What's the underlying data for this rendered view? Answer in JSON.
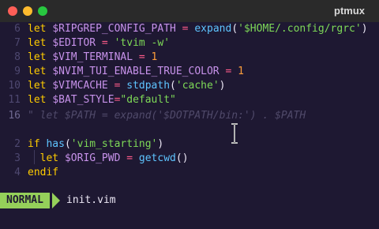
{
  "window": {
    "title": "ptmux"
  },
  "editor": {
    "lines": [
      {
        "num": "6",
        "tokens": [
          [
            "kw",
            "let "
          ],
          [
            "var",
            "$RIPGREP_CONFIG_PATH"
          ],
          [
            "op",
            " = "
          ],
          [
            "fn",
            "expand"
          ],
          [
            "plain",
            "("
          ],
          [
            "str",
            "'$HOME/.config/rgrc'"
          ],
          [
            "plain",
            ")"
          ]
        ]
      },
      {
        "num": "7",
        "tokens": [
          [
            "kw",
            "let "
          ],
          [
            "var",
            "$EDITOR"
          ],
          [
            "op",
            " = "
          ],
          [
            "str",
            "'tvim -w'"
          ]
        ]
      },
      {
        "num": "8",
        "tokens": [
          [
            "kw",
            "let "
          ],
          [
            "var",
            "$VIM_TERMINAL"
          ],
          [
            "op",
            " = "
          ],
          [
            "num",
            "1"
          ]
        ]
      },
      {
        "num": "9",
        "tokens": [
          [
            "kw",
            "let "
          ],
          [
            "var",
            "$NVIM_TUI_ENABLE_TRUE_COLOR"
          ],
          [
            "op",
            " = "
          ],
          [
            "num",
            "1"
          ]
        ]
      },
      {
        "num": "10",
        "tokens": [
          [
            "kw",
            "let "
          ],
          [
            "var",
            "$VIMCACHE"
          ],
          [
            "op",
            " = "
          ],
          [
            "fn",
            "stdpath"
          ],
          [
            "plain",
            "("
          ],
          [
            "str",
            "'cache'"
          ],
          [
            "plain",
            ")"
          ]
        ]
      },
      {
        "num": "11",
        "tokens": [
          [
            "kw",
            "let "
          ],
          [
            "var",
            "$BAT_STYLE"
          ],
          [
            "op",
            "="
          ],
          [
            "str",
            "\"default\""
          ]
        ]
      },
      {
        "num": "16",
        "current": true,
        "tokens": [
          [
            "comment",
            "\" let $PATH = expand('$DOTPATH/bin:') . $PATH"
          ]
        ]
      },
      {
        "num": "",
        "tokens": []
      },
      {
        "num": "2",
        "tokens": [
          [
            "kw",
            "if "
          ],
          [
            "fn",
            "has"
          ],
          [
            "plain",
            "("
          ],
          [
            "str",
            "'vim_starting'"
          ],
          [
            "plain",
            ")"
          ]
        ]
      },
      {
        "num": "3",
        "tokens": [
          [
            "plain",
            "  "
          ],
          [
            "kw",
            "let "
          ],
          [
            "var",
            "$ORIG_PWD"
          ],
          [
            "op",
            " = "
          ],
          [
            "fn",
            "getcwd"
          ],
          [
            "plain",
            "()"
          ]
        ]
      },
      {
        "num": "4",
        "tokens": [
          [
            "kw",
            "endif"
          ]
        ]
      }
    ]
  },
  "statusline": {
    "mode": "NORMAL",
    "filename": "init.vim"
  },
  "colors": {
    "background": "#1e1832",
    "mode_bg": "#95d05a",
    "keyword": "#ffcc00",
    "variable": "#c792ea",
    "string": "#7ed957",
    "operator": "#ff5c8a",
    "number": "#ff9e3b",
    "function": "#5ec4ff"
  }
}
